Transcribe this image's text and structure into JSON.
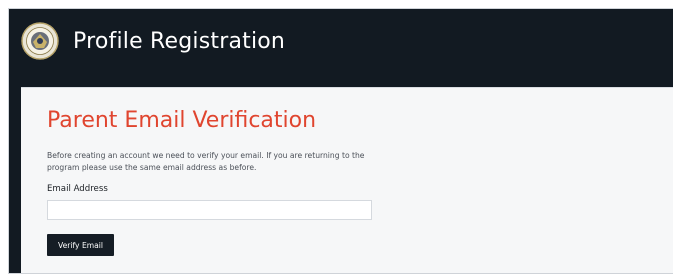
{
  "header": {
    "title": "Profile Registration",
    "logo_icon": "seal-logo-icon"
  },
  "verification": {
    "heading": "Parent Email Verification",
    "intro": "Before creating an account we need to verify your email. If you are returning to the program please use the same email address as before.",
    "email_label": "Email Address",
    "email_value": "",
    "email_placeholder": "",
    "button_label": "Verify Email"
  },
  "colors": {
    "header_bg": "#121a22",
    "heading_accent": "#e0452f",
    "panel_bg": "#f6f7f8",
    "button_bg": "#151d25"
  }
}
